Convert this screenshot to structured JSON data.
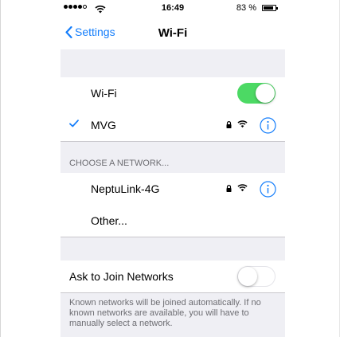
{
  "status": {
    "time": "16:49",
    "battery_percent_text": "83 %",
    "battery_level": 0.83,
    "signal_filled": 4,
    "signal_total": 5
  },
  "nav": {
    "back_label": "Settings",
    "title": "Wi-Fi"
  },
  "wifi_row": {
    "label": "Wi-Fi",
    "enabled": true
  },
  "connected_network": {
    "name": "MVG",
    "secured": true
  },
  "choose_section": {
    "header": "CHOOSE A NETWORK...",
    "networks": [
      {
        "name": "NeptuLink-4G",
        "secured": true
      }
    ],
    "other_label": "Other..."
  },
  "ask_to_join": {
    "label": "Ask to Join Networks",
    "enabled": false,
    "footer": "Known networks will be joined automatically. If no known networks are available, you will have to manually select a network."
  },
  "colors": {
    "accent": "#157efb",
    "toggle_on": "#4cd964",
    "grouped_background": "#efeff4",
    "footer_text": "#6d6d72"
  }
}
